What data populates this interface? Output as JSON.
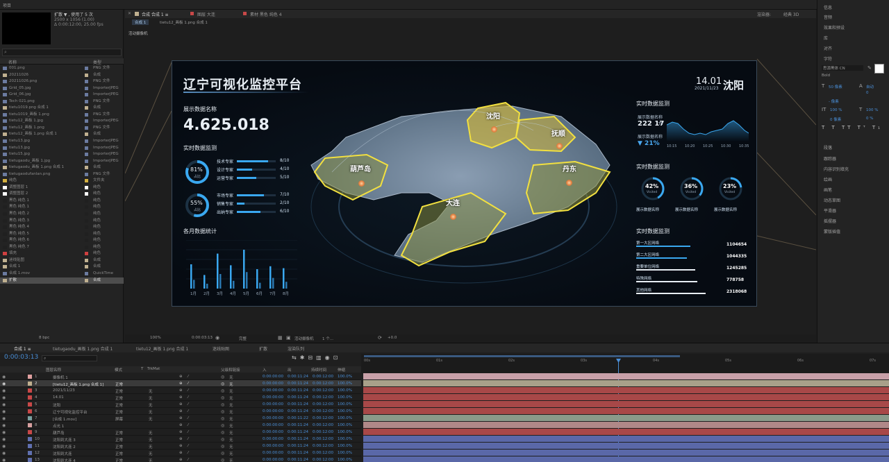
{
  "topbar": {
    "project_label": "项目"
  },
  "project": {
    "file_name": "扩散 ▼ , 使用了 5 次",
    "file_size": "2500 x 1056 (1.00)",
    "file_duration": "Δ 0:00:12:00, 25.00 fps",
    "col_name": "名称",
    "col_type": "类型",
    "items": [
      {
        "name": "001.png",
        "type": "PNG 文件",
        "c": "#6b7ba0"
      },
      {
        "name": "20211026",
        "type": "合成",
        "c": "#c0b090"
      },
      {
        "name": "20211026.png",
        "type": "PNG 文件",
        "c": "#6b7ba0"
      },
      {
        "name": "Grid_05.jpg",
        "type": "ImporterJPEG",
        "c": "#6b7ba0"
      },
      {
        "name": "Grid_06.jpg",
        "type": "ImporterJPEG",
        "c": "#6b7ba0"
      },
      {
        "name": "Tech 021.png",
        "type": "PNG 文件",
        "c": "#6b7ba0"
      },
      {
        "name": "tietu1019.png 合成 1",
        "type": "合成",
        "c": "#c0b090"
      },
      {
        "name": "tietu1019_画板 1.png",
        "type": "PNG 文件",
        "c": "#6b7ba0"
      },
      {
        "name": "tietu12_画板 1.jpg",
        "type": "ImporterJPEG",
        "c": "#6b7ba0"
      },
      {
        "name": "tietu12_画板 1.png",
        "type": "PNG 文件",
        "c": "#6b7ba0"
      },
      {
        "name": "tietu12_画板 1.png 合成 1",
        "type": "合成",
        "c": "#c0b090"
      },
      {
        "name": "tietu13.jpg",
        "type": "ImporterJPEG",
        "c": "#6b7ba0"
      },
      {
        "name": "tietu13.jpg",
        "type": "ImporterJPEG",
        "c": "#6b7ba0"
      },
      {
        "name": "tietu15.jpg",
        "type": "ImporterJPEG",
        "c": "#6b7ba0"
      },
      {
        "name": "tietugaodu_画板 1.jpg",
        "type": "ImporterJPEG",
        "c": "#6b7ba0"
      },
      {
        "name": "tietugaodu_画板 1.png 合成 1",
        "type": "合成",
        "c": "#c0b090"
      },
      {
        "name": "tietugaodufanlan.png",
        "type": "PNG 文件",
        "c": "#6b7ba0"
      },
      {
        "name": "纯色",
        "type": "文件夹",
        "c": "#d4b040"
      },
      {
        "name": "调整图层 1",
        "type": "纯色",
        "c": "#ffffff"
      },
      {
        "name": "调整图层 2",
        "type": "纯色",
        "c": "#ffffff"
      },
      {
        "name": "黑色 纯色 1",
        "type": "纯色",
        "c": "#202020"
      },
      {
        "name": "黑色 纯色 1",
        "type": "纯色",
        "c": "#202020"
      },
      {
        "name": "黑色 纯色 2",
        "type": "纯色",
        "c": "#202020"
      },
      {
        "name": "黑色 纯色 3",
        "type": "纯色",
        "c": "#202020"
      },
      {
        "name": "黑色 纯色 4",
        "type": "纯色",
        "c": "#202020"
      },
      {
        "name": "黑色 纯色 5",
        "type": "纯色",
        "c": "#202020"
      },
      {
        "name": "黑色 纯色 6",
        "type": "纯色",
        "c": "#202020"
      },
      {
        "name": "黑色 纯色 7",
        "type": "纯色",
        "c": "#202020"
      },
      {
        "name": "填充",
        "type": "纯色",
        "c": "#d04040"
      },
      {
        "name": "迷线贴图",
        "type": "合成",
        "c": "#c0b090"
      },
      {
        "name": "合成 1",
        "type": "合成",
        "c": "#c0b090"
      },
      {
        "name": "合成 1.mov",
        "type": "QuickTime",
        "c": "#6b7ba0"
      },
      {
        "name": "扩散",
        "type": "合成",
        "c": "#c0b090",
        "sel": true
      }
    ],
    "bpc": "8 bpc"
  },
  "viewer": {
    "tab_comp": "合成 合成 1 ≡",
    "tab_layer": "图层 大连",
    "tab_footage": "素材 黑色 纯色 4",
    "sub_comp": "合成 1",
    "sub_file": "tietu12_画板 1.png 合成 1",
    "active_camera": "活动摄像机",
    "renderer": "渲染器:",
    "renderer_value": "经典 3D",
    "zoom": "100%",
    "timecode": "0:00:03:13",
    "resolution": "完整",
    "camera_select": "活动摄像机",
    "view_count": "1 个...",
    "exposure": "+0.0"
  },
  "dashboard": {
    "title": "辽宁可视化监控平台",
    "time": "14.01",
    "date": "2021/11/23",
    "city": "沈阳",
    "left": {
      "label1": "展示数据名称",
      "bignum": "4.625.018",
      "section2": "实时数据监测",
      "ring1": {
        "pct": "81%",
        "sub": "占比",
        "value": 0.81
      },
      "ring2": {
        "pct": "55%",
        "sub": "占比",
        "value": 0.55
      },
      "g1": [
        {
          "label": "技术专家",
          "val": "8/10",
          "v": 0.8
        },
        {
          "label": "设计专家",
          "val": "4/10",
          "v": 0.4
        },
        {
          "label": "运营专家",
          "val": "5/10",
          "v": 0.5
        }
      ],
      "g2": [
        {
          "label": "市场专家",
          "val": "7/10",
          "v": 0.7
        },
        {
          "label": "销售专家",
          "val": "2/10",
          "v": 0.2
        },
        {
          "label": "出纳专家",
          "val": "6/10",
          "v": 0.6
        }
      ],
      "section3": "各月数据统计"
    },
    "chart_data": {
      "type": "bar",
      "categories": [
        "1月",
        "2月",
        "3月",
        "4月",
        "5月",
        "6月",
        "7月",
        "8月"
      ],
      "series": [
        {
          "values": [
            50,
            28,
            72,
            48,
            80,
            40,
            46,
            42
          ]
        },
        {
          "values": [
            18,
            10,
            30,
            16,
            34,
            12,
            22,
            14
          ]
        }
      ],
      "ylim": [
        0,
        100
      ]
    },
    "cities": [
      "沈阳",
      "抚顺",
      "葫芦岛",
      "丹东",
      "大连"
    ],
    "right": {
      "section1": "实时数据监测",
      "name": "展示数据名称",
      "value": "222 17",
      "unit": "TB",
      "change": "▼ 21%",
      "line_x": [
        "10:15",
        "10:20",
        "10:25",
        "10:30",
        "10:35"
      ],
      "section2": "实时数据监测",
      "rings": [
        {
          "pct": "42%",
          "sub": "Visited",
          "label": "展示数据名称",
          "v": 0.42
        },
        {
          "pct": "36%",
          "sub": "Visited",
          "label": "展示数据名称",
          "v": 0.36
        },
        {
          "pct": "23%",
          "sub": "Visited",
          "label": "展示数据名称",
          "v": 0.23
        }
      ],
      "section3": "实时数据监测",
      "list": [
        {
          "label": "第一大区网络",
          "value": "1104654",
          "v": 0.62
        },
        {
          "label": "第二大区网络",
          "value": "1044335",
          "v": 0.58
        },
        {
          "label": "重要单位网络",
          "value": "1245285",
          "v": 0.68
        },
        {
          "label": "特殊网络",
          "value": "778758",
          "v": 0.7
        },
        {
          "label": "其他网络",
          "value": "2318068",
          "v": 0.8
        }
      ]
    }
  },
  "right_panel": {
    "items": [
      "信息",
      "音频",
      "效果和预设",
      "库",
      "对齐",
      "字符",
      "段落",
      "跟踪器",
      "内容识别填充",
      "绘画",
      "画笔",
      "动态草图",
      "平滑器",
      "摇摆器",
      "蒙版插值"
    ],
    "font": "思源黑体 CN",
    "weight": "Bold",
    "size": "50 像素",
    "auto": "自动",
    "tracking": "0",
    "px": "- 像素",
    "scale1": "100 %",
    "scale2": "100 %",
    "baseline": "0 像素",
    "tsume": "0 %"
  },
  "timeline": {
    "tabs": [
      "合成 1 ≡",
      "tietugaodu_画板 1.png 合成 1",
      "tietu12_画板 1.png 合成 1",
      "迷线贴图",
      "扩散",
      "渲染队列"
    ],
    "timecode": "0:00:03:13",
    "cols": {
      "name": "图层名称",
      "mode": "模式",
      "t": "T",
      "trkmat": "TrkMat",
      "parent": "父级和链接",
      "in": "入",
      "out": "出",
      "dur": "持续时间",
      "stretch": "伸缩"
    },
    "ruler": [
      "00s",
      "01s",
      "02s",
      "03s",
      "04s",
      "05s",
      "06s",
      "07s"
    ],
    "layers": [
      {
        "n": "1",
        "name": "摄像机 1",
        "mode": "",
        "trk": "",
        "parent": "无",
        "in": "0:00:00:00",
        "out": "0:00:11:24",
        "dur": "0:00:12:00",
        "st": "100.0%",
        "c": "#e0a0a0",
        "bar": "#c8a0a8"
      },
      {
        "n": "2",
        "name": "[tietu12_画板 1.png 合成 1]",
        "mode": "正常",
        "trk": "",
        "parent": "无",
        "in": "0:00:00:00",
        "out": "0:00:11:24",
        "dur": "0:00:12:00",
        "st": "100.0%",
        "c": "#c0b090",
        "bar": "#a8a08a",
        "sel": true
      },
      {
        "n": "3",
        "name": "2021/11/23",
        "mode": "正常",
        "trk": "无",
        "parent": "无",
        "in": "0:00:00:00",
        "out": "0:00:11:24",
        "dur": "0:00:12:00",
        "st": "100.0%",
        "c": "#c84848",
        "bar": "#a84848"
      },
      {
        "n": "4",
        "name": "14.01",
        "mode": "正常",
        "trk": "无",
        "parent": "无",
        "in": "0:00:00:00",
        "out": "0:00:11:24",
        "dur": "0:00:12:00",
        "st": "100.0%",
        "c": "#c84848",
        "bar": "#a84848"
      },
      {
        "n": "5",
        "name": "沈阳",
        "mode": "正常",
        "trk": "无",
        "parent": "无",
        "in": "0:00:00:00",
        "out": "0:00:11:24",
        "dur": "0:00:12:00",
        "st": "100.0%",
        "c": "#c84848",
        "bar": "#a84848"
      },
      {
        "n": "6",
        "name": "辽宁可视化监控平台",
        "mode": "正常",
        "trk": "无",
        "parent": "无",
        "in": "0:00:00:00",
        "out": "0:00:11:24",
        "dur": "0:00:12:00",
        "st": "100.0%",
        "c": "#c84848",
        "bar": "#a84848"
      },
      {
        "n": "7",
        "name": "[合成 1.mov]",
        "mode": "屏幕",
        "trk": "无",
        "parent": "无",
        "in": "0:00:00:00",
        "out": "0:00:11:22",
        "dur": "0:00:12:00",
        "st": "100.0%",
        "c": "#7aa0a0",
        "bar": "#8a9a8a"
      },
      {
        "n": "8",
        "name": "点光 1",
        "mode": "",
        "trk": "",
        "parent": "无",
        "in": "0:00:00:00",
        "out": "0:00:11:24",
        "dur": "0:00:12:00",
        "st": "100.0%",
        "c": "#d8a0a0",
        "bar": "#b08888"
      },
      {
        "n": "9",
        "name": "葫芦岛",
        "mode": "正常",
        "trk": "无",
        "parent": "无",
        "in": "0:00:00:00",
        "out": "0:00:11:24",
        "dur": "0:00:12:00",
        "st": "100.0%",
        "c": "#c84848",
        "bar": "#a84848"
      },
      {
        "n": "10",
        "name": "沈阳到大连 3",
        "mode": "正常",
        "trk": "无",
        "parent": "无",
        "in": "0:00:00:00",
        "out": "0:00:11:24",
        "dur": "0:00:12:00",
        "st": "100.0%",
        "c": "#6070b0",
        "bar": "#5a68a8"
      },
      {
        "n": "11",
        "name": "沈阳到大连 2",
        "mode": "正常",
        "trk": "无",
        "parent": "无",
        "in": "0:00:00:00",
        "out": "0:00:11:24",
        "dur": "0:00:12:00",
        "st": "100.0%",
        "c": "#6070b0",
        "bar": "#5a68a8"
      },
      {
        "n": "12",
        "name": "沈阳到大连",
        "mode": "正常",
        "trk": "无",
        "parent": "无",
        "in": "0:00:00:00",
        "out": "0:00:11:24",
        "dur": "0:00:12:00",
        "st": "100.0%",
        "c": "#6070b0",
        "bar": "#5a68a8"
      },
      {
        "n": "13",
        "name": "沈阳到大连 4",
        "mode": "正常",
        "trk": "无",
        "parent": "无",
        "in": "0:00:00:00",
        "out": "0:00:11:24",
        "dur": "0:00:12:00",
        "st": "100.0%",
        "c": "#6070b0",
        "bar": "#5a68a8"
      }
    ]
  }
}
